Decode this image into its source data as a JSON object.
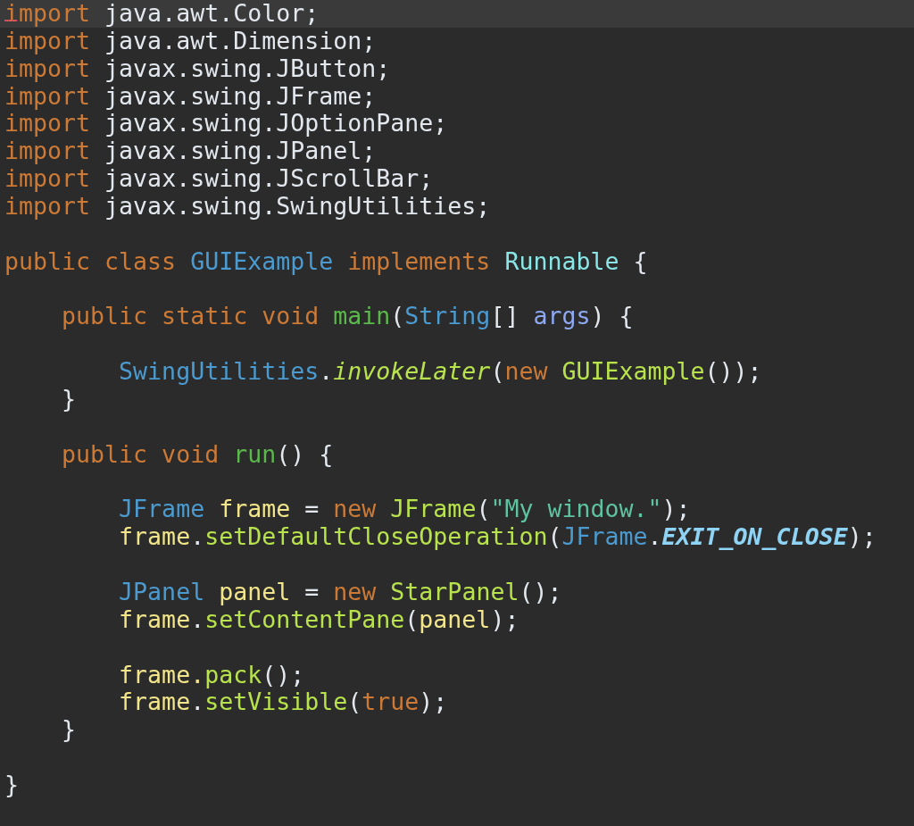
{
  "editor": {
    "lines": [
      {
        "current": true,
        "squiggle": true,
        "tokens": [
          {
            "text": "import",
            "kind": "keyword"
          },
          {
            "text": " java.awt.Color;",
            "kind": "plain"
          }
        ]
      },
      {
        "current": false,
        "squiggle": false,
        "tokens": [
          {
            "text": "import",
            "kind": "keyword"
          },
          {
            "text": " java.awt.Dimension;",
            "kind": "plain"
          }
        ]
      },
      {
        "current": false,
        "squiggle": false,
        "tokens": [
          {
            "text": "import",
            "kind": "keyword"
          },
          {
            "text": " javax.swing.JButton;",
            "kind": "plain"
          }
        ]
      },
      {
        "current": false,
        "squiggle": false,
        "tokens": [
          {
            "text": "import",
            "kind": "keyword"
          },
          {
            "text": " javax.swing.JFrame;",
            "kind": "plain"
          }
        ]
      },
      {
        "current": false,
        "squiggle": false,
        "tokens": [
          {
            "text": "import",
            "kind": "keyword"
          },
          {
            "text": " javax.swing.JOptionPane;",
            "kind": "plain"
          }
        ]
      },
      {
        "current": false,
        "squiggle": false,
        "tokens": [
          {
            "text": "import",
            "kind": "keyword"
          },
          {
            "text": " javax.swing.JPanel;",
            "kind": "plain"
          }
        ]
      },
      {
        "current": false,
        "squiggle": false,
        "tokens": [
          {
            "text": "import",
            "kind": "keyword"
          },
          {
            "text": " javax.swing.JScrollBar;",
            "kind": "plain"
          }
        ]
      },
      {
        "current": false,
        "squiggle": false,
        "tokens": [
          {
            "text": "import",
            "kind": "keyword"
          },
          {
            "text": " javax.swing.SwingUtilities;",
            "kind": "plain"
          }
        ]
      },
      {
        "current": false,
        "squiggle": false
      },
      {
        "current": false,
        "squiggle": false,
        "tokens": [
          {
            "text": "public class ",
            "kind": "keyword"
          },
          {
            "text": "GUIExample",
            "kind": "type"
          },
          {
            "text": " implements ",
            "kind": "keyword"
          },
          {
            "text": "Runnable",
            "kind": "interface"
          },
          {
            "text": " {",
            "kind": "plain"
          }
        ]
      },
      {
        "current": false,
        "squiggle": false
      },
      {
        "current": false,
        "squiggle": false,
        "tokens": [
          {
            "text": "    public static void ",
            "kind": "keyword"
          },
          {
            "text": "main",
            "kind": "definition"
          },
          {
            "text": "(",
            "kind": "plain"
          },
          {
            "text": "String",
            "kind": "type"
          },
          {
            "text": "[] ",
            "kind": "plain"
          },
          {
            "text": "args",
            "kind": "parameter"
          },
          {
            "text": ") {",
            "kind": "plain"
          }
        ]
      },
      {
        "current": false,
        "squiggle": false
      },
      {
        "current": false,
        "squiggle": false,
        "tokens": [
          {
            "text": "        SwingUtilities",
            "kind": "type"
          },
          {
            "text": ".",
            "kind": "plain"
          },
          {
            "text": "invokeLater",
            "kind": "static_call"
          },
          {
            "text": "(",
            "kind": "plain"
          },
          {
            "text": "new ",
            "kind": "keyword"
          },
          {
            "text": "GUIExample",
            "kind": "call"
          },
          {
            "text": "());",
            "kind": "plain"
          }
        ]
      },
      {
        "current": false,
        "squiggle": false,
        "tokens": [
          {
            "text": "    }",
            "kind": "plain"
          }
        ]
      },
      {
        "current": false,
        "squiggle": false
      },
      {
        "current": false,
        "squiggle": false,
        "tokens": [
          {
            "text": "    public void ",
            "kind": "keyword"
          },
          {
            "text": "run",
            "kind": "definition"
          },
          {
            "text": "() {",
            "kind": "plain"
          }
        ]
      },
      {
        "current": false,
        "squiggle": false
      },
      {
        "current": false,
        "squiggle": false,
        "tokens": [
          {
            "text": "        JFrame ",
            "kind": "type"
          },
          {
            "text": "frame",
            "kind": "local"
          },
          {
            "text": " = ",
            "kind": "plain"
          },
          {
            "text": "new ",
            "kind": "keyword"
          },
          {
            "text": "JFrame",
            "kind": "call"
          },
          {
            "text": "(",
            "kind": "plain"
          },
          {
            "text": "\"My window.\"",
            "kind": "string"
          },
          {
            "text": ");",
            "kind": "plain"
          }
        ]
      },
      {
        "current": false,
        "squiggle": false,
        "tokens": [
          {
            "text": "        frame",
            "kind": "local"
          },
          {
            "text": ".",
            "kind": "plain"
          },
          {
            "text": "setDefaultCloseOperation",
            "kind": "call"
          },
          {
            "text": "(",
            "kind": "plain"
          },
          {
            "text": "JFrame",
            "kind": "type"
          },
          {
            "text": ".",
            "kind": "plain"
          },
          {
            "text": "EXIT_ON_CLOSE",
            "kind": "constant"
          },
          {
            "text": ");",
            "kind": "plain"
          }
        ]
      },
      {
        "current": false,
        "squiggle": false
      },
      {
        "current": false,
        "squiggle": false,
        "tokens": [
          {
            "text": "        JPanel ",
            "kind": "type"
          },
          {
            "text": "panel",
            "kind": "local"
          },
          {
            "text": " = ",
            "kind": "plain"
          },
          {
            "text": "new ",
            "kind": "keyword"
          },
          {
            "text": "StarPanel",
            "kind": "call"
          },
          {
            "text": "();",
            "kind": "plain"
          }
        ]
      },
      {
        "current": false,
        "squiggle": false,
        "tokens": [
          {
            "text": "        frame",
            "kind": "local"
          },
          {
            "text": ".",
            "kind": "plain"
          },
          {
            "text": "setContentPane",
            "kind": "call"
          },
          {
            "text": "(",
            "kind": "plain"
          },
          {
            "text": "panel",
            "kind": "local"
          },
          {
            "text": ");",
            "kind": "plain"
          }
        ]
      },
      {
        "current": false,
        "squiggle": false
      },
      {
        "current": false,
        "squiggle": false,
        "tokens": [
          {
            "text": "        frame.",
            "kind": "local"
          },
          {
            "text": "pack",
            "kind": "call"
          },
          {
            "text": "();",
            "kind": "plain"
          }
        ]
      },
      {
        "current": false,
        "squiggle": false,
        "tokens": [
          {
            "text": "        frame",
            "kind": "local"
          },
          {
            "text": ".",
            "kind": "plain"
          },
          {
            "text": "setVisible",
            "kind": "call"
          },
          {
            "text": "(",
            "kind": "plain"
          },
          {
            "text": "true",
            "kind": "keyword"
          },
          {
            "text": ");",
            "kind": "plain"
          }
        ]
      },
      {
        "current": false,
        "squiggle": false,
        "tokens": [
          {
            "text": "    }",
            "kind": "plain"
          }
        ]
      },
      {
        "current": false,
        "squiggle": false
      },
      {
        "current": false,
        "squiggle": false,
        "tokens": [
          {
            "text": "}",
            "kind": "plain"
          }
        ]
      }
    ]
  }
}
